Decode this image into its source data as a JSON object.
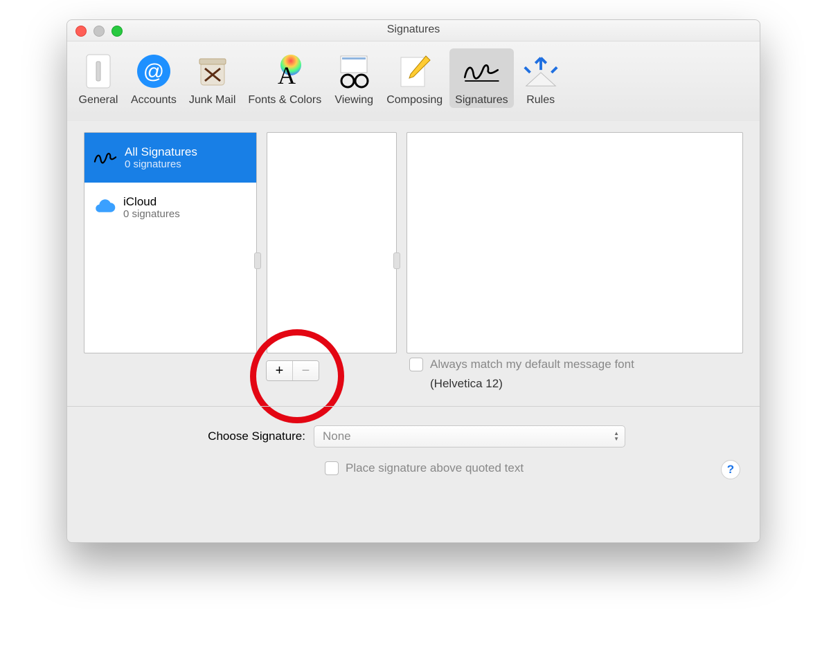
{
  "window": {
    "title": "Signatures"
  },
  "toolbar": {
    "items": [
      {
        "label": "General"
      },
      {
        "label": "Accounts"
      },
      {
        "label": "Junk Mail"
      },
      {
        "label": "Fonts & Colors"
      },
      {
        "label": "Viewing"
      },
      {
        "label": "Composing"
      },
      {
        "label": "Signatures"
      },
      {
        "label": "Rules"
      }
    ],
    "active_index": 6
  },
  "accounts": [
    {
      "title": "All Signatures",
      "subtitle": "0 signatures",
      "selected": true
    },
    {
      "title": "iCloud",
      "subtitle": "0 signatures",
      "selected": false
    }
  ],
  "always_match": {
    "label": "Always match my default message font",
    "font_line": "(Helvetica 12)",
    "checked": false
  },
  "choose": {
    "label": "Choose Signature:",
    "value": "None"
  },
  "place_above": {
    "label": "Place signature above quoted text",
    "checked": false
  },
  "help_glyph": "?",
  "buttons": {
    "add": "+",
    "remove": "−"
  }
}
